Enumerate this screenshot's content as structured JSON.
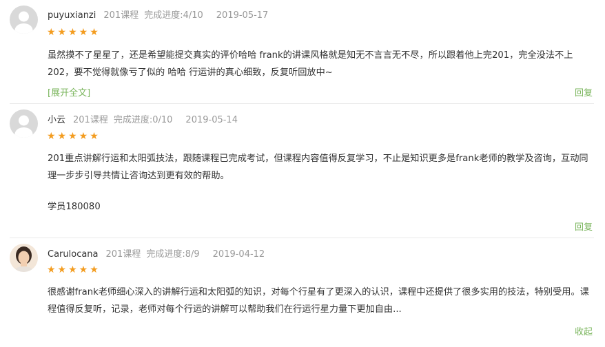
{
  "reviews": [
    {
      "user": "puyuxianzi",
      "course": "201课程",
      "progress": "完成进度:4/10",
      "date": "2019-05-17",
      "stars_text": "★★★★★",
      "rating": 5,
      "content": "虽然摸不了星星了，还是希望能提交真实的评价哈哈 frank的讲课风格就是知无不言言无不尽，所以跟着他上完201，完全没法不上202，要不觉得就像亏了似的 哈哈 行运讲的真心细致，反复听回放中~",
      "expand_label": "[展开全文]",
      "action_label": "回复"
    },
    {
      "user": "小云",
      "course": "201课程",
      "progress": "完成进度:0/10",
      "date": "2019-05-14",
      "stars_text": "★★★★★",
      "rating": 5,
      "content": "201重点讲解行运和太阳弧技法，跟随课程已完成考试，但课程内容值得反复学习，不止是知识更多是frank老师的教学及咨询，互动同理一步步引导共情让咨询达到更有效的帮助。",
      "extra": "学员180080",
      "action_label": "回复"
    },
    {
      "user": "Carulocana",
      "course": "201课程",
      "progress": "完成进度:8/9",
      "date": "2019-04-12",
      "stars_text": "★★★★★",
      "rating": 5,
      "content": "很感谢frank老师细心深入的讲解行运和太阳弧的知识，对每个行星有了更深入的认识，课程中还提供了很多实用的技法，特别受用。课程值得反复听，记录，老师对每个行运的讲解可以帮助我们在行运行星力量下更加自由...",
      "action_label": "收起"
    }
  ]
}
